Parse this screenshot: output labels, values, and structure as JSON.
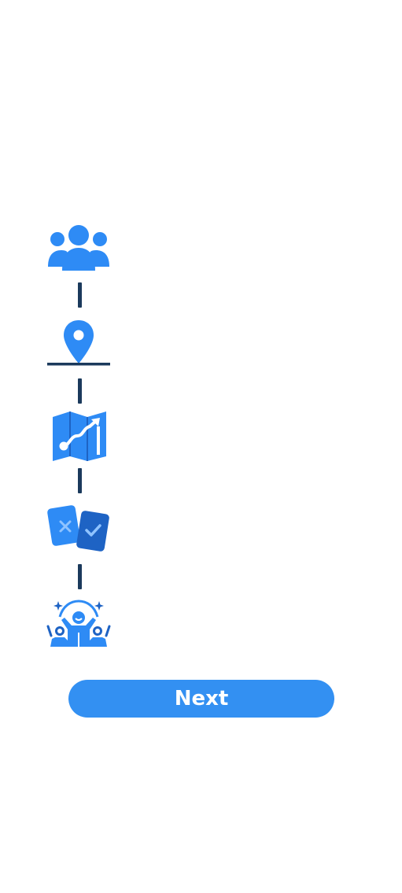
{
  "colors": {
    "icon_primary": "#2E8BF5",
    "icon_dark": "#1E63C4",
    "icon_light": "#8FC3FF",
    "connector": "#1B3A5C",
    "button_bg": "#3390F2",
    "button_text": "#FFFFFF",
    "background": "#FFFFFF"
  },
  "steps": [
    {
      "icon": "group-icon"
    },
    {
      "icon": "location-pin-icon"
    },
    {
      "icon": "route-map-icon"
    },
    {
      "icon": "decision-cards-icon"
    },
    {
      "icon": "celebration-icon"
    }
  ],
  "actions": {
    "next_label": "Next"
  }
}
